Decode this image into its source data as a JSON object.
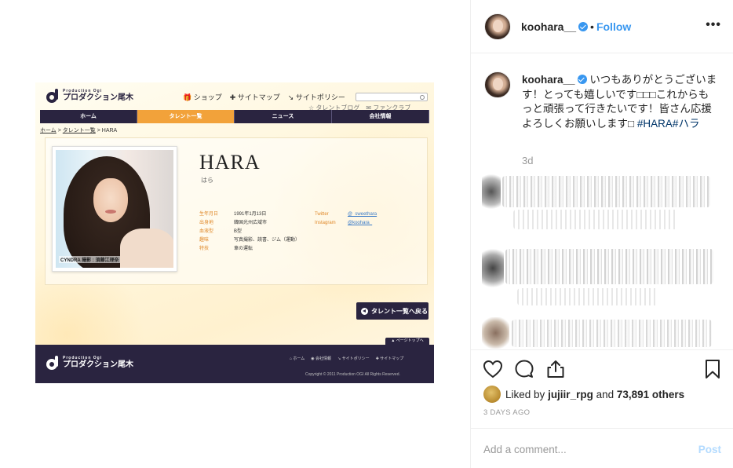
{
  "post": {
    "username": "koohara__",
    "follow_label": "Follow",
    "separator": "•",
    "more_label": "•••",
    "caption_text": "いつもありがとうございます！とっても嬉しいです□□□これからもっと頑張って行きたいです！皆さん応援よろしくお願いします□",
    "caption_tags": "#HARA#ハラ",
    "caption_age": "3d",
    "liked_by_prefix": "Liked by",
    "liked_by_user": "jujiir_rpg",
    "liked_by_and": "and",
    "likes_count": "73,891 others",
    "posted_ago": "3 DAYS AGO",
    "comment_placeholder": "Add a comment...",
    "post_label": "Post"
  },
  "site": {
    "logo_small": "Production Ogi",
    "logo_big": "プロダクション尾木",
    "top_links": [
      "ショップ",
      "サイトマップ",
      "サイトポリシー"
    ],
    "sub_links": [
      "タレントブログ",
      "ファンクラブ"
    ],
    "nav": [
      "ホーム",
      "タレント一覧",
      "ニュース",
      "会社情報"
    ],
    "nav_active_index": 1,
    "breadcrumb": {
      "home": "ホーム",
      "list": "タレント一覧",
      "current": "HARA"
    },
    "talent_name": "HARA",
    "talent_kana": "はら",
    "photo_caption": "CYNDRA 撮影 : 須藤江理奈",
    "profile": [
      {
        "k": "生年月日",
        "v": "1991年1月13日"
      },
      {
        "k": "出身地",
        "v": "韓国光州広域市"
      },
      {
        "k": "血液型",
        "v": "B型"
      },
      {
        "k": "趣味",
        "v": "写真撮影、読書、ジム（運動）"
      },
      {
        "k": "特技",
        "v": "車の運転"
      }
    ],
    "sns": [
      {
        "k": "Twitter",
        "v": "@_sweethara"
      },
      {
        "k": "Instagram",
        "v": "@koohara_"
      }
    ],
    "back_label": "タレント一覧へ戻る",
    "pagetop_label": "▲ ページトップへ",
    "footer_links": [
      "ホーム",
      "会社情報",
      "サイトポリシー",
      "サイトマップ"
    ],
    "copyright": "Copyright © 2011 Production OGI All Rights Reserved."
  },
  "colors": {
    "accent_blue": "#3897f0",
    "site_navy": "#2a2440",
    "site_orange": "#f2a23a",
    "hashtag": "#003569"
  },
  "icons": [
    "heart-icon",
    "comment-icon",
    "share-icon",
    "bookmark-icon",
    "verified-badge-icon",
    "more-options-icon"
  ]
}
